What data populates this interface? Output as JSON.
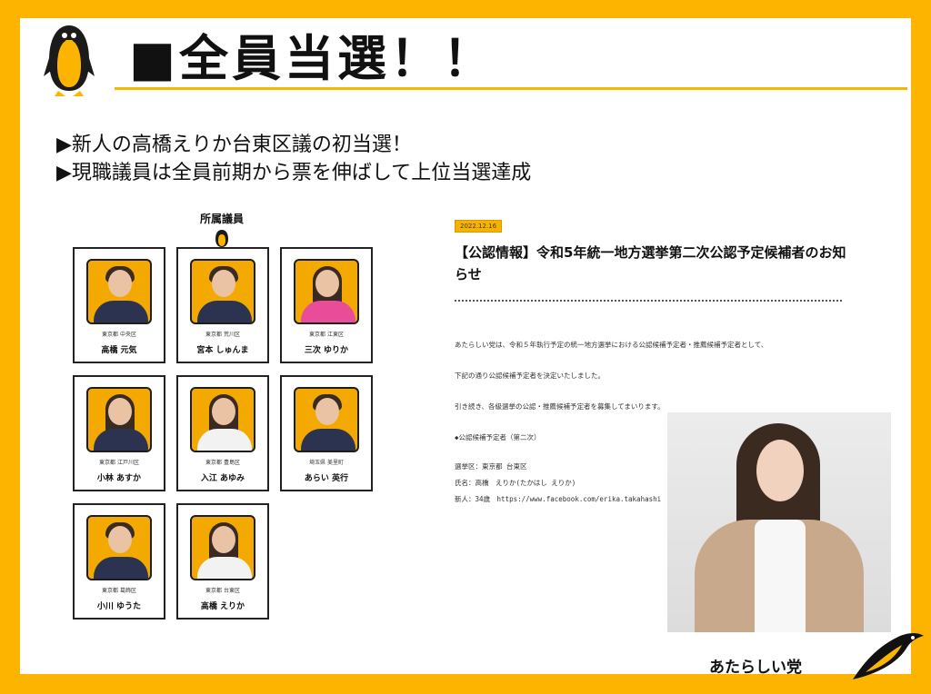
{
  "title": "■全員当選！！",
  "bullets": [
    "▶新人の高橋えりか台東区議の初当選！",
    "▶現職議員は全員前期から票を伸ばして上位当選達成"
  ],
  "members_heading": "所属議員",
  "members": [
    {
      "pref": "東京都 中央区",
      "name": "高橋 元気"
    },
    {
      "pref": "東京都 荒川区",
      "name": "宮本 しゅんま"
    },
    {
      "pref": "東京都 江東区",
      "name": "三次 ゆりか"
    },
    {
      "pref": "東京都 江戸川区",
      "name": "小林 あすか"
    },
    {
      "pref": "東京都 豊島区",
      "name": "入江 あゆみ"
    },
    {
      "pref": "埼玉県 美里町",
      "name": "あらい 英行"
    },
    {
      "pref": "東京都 葛飾区",
      "name": "小川 ゆうた"
    },
    {
      "pref": "東京都 台東区",
      "name": "高橋 えりか"
    }
  ],
  "notice": {
    "date": "2022.12.16",
    "title": "【公認情報】令和5年統一地方選挙第二次公認予定候補者のお知らせ",
    "lines": [
      "あたらしい党は、令和５年執行予定の統一地方選挙における公認候補予定者・推薦候補予定者として、",
      "下記の通り公認候補予定者を決定いたしました。",
      "引き続き、各級選挙の公認・推薦候補予定者を募集してまいります。",
      "◆公認候補予定者（第二次）",
      "選挙区：東京都 台東区",
      "氏名：高橋　えりか(たかはし えりか)",
      "新人：34歳　https://www.facebook.com/erika.takahashi"
    ]
  },
  "brand": "あたらしい党",
  "colors": {
    "accent": "#fcb400",
    "text": "#111111"
  }
}
